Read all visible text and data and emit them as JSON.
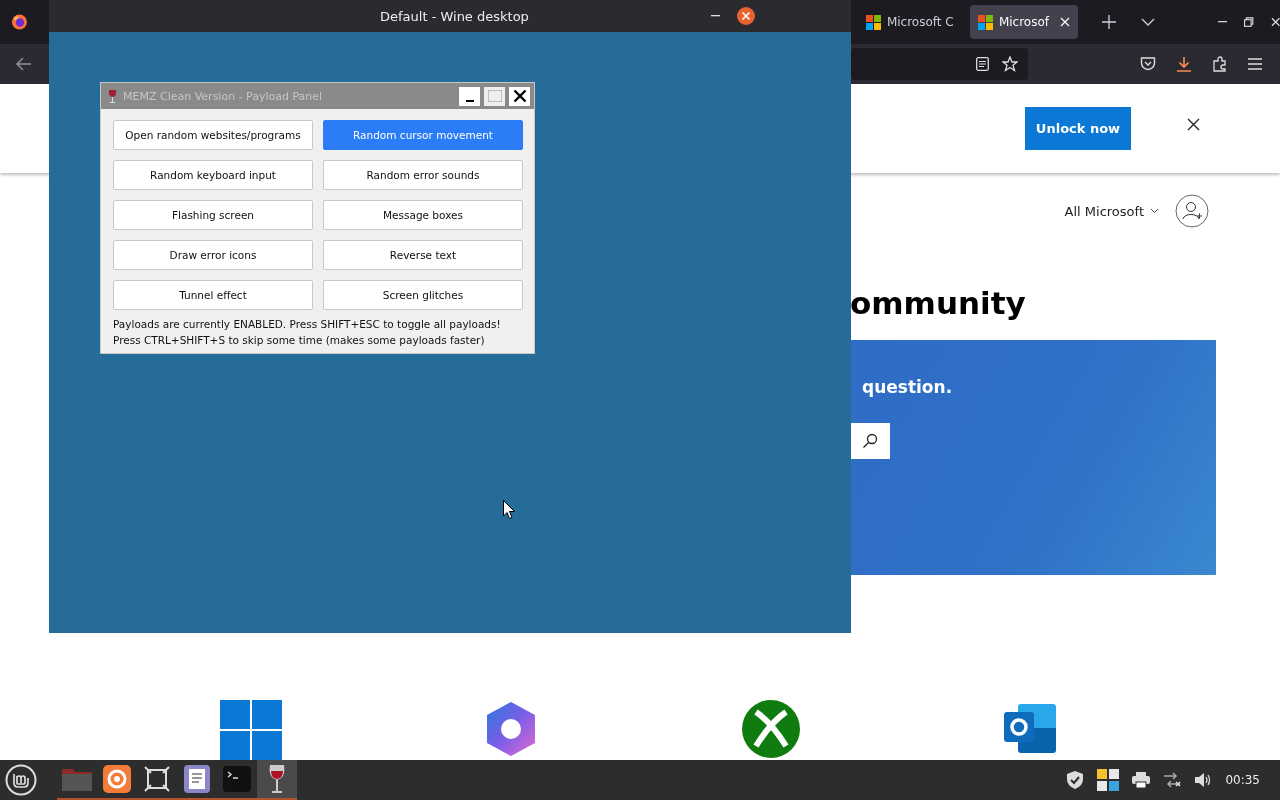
{
  "browser": {
    "tabs": [
      {
        "title": "Microsoft C",
        "selected": false
      },
      {
        "title": "Microsof",
        "selected": true
      }
    ]
  },
  "page": {
    "banner_button": "Unlock now",
    "nav_menu": "All Microsoft",
    "heading": "ommunity",
    "hero_text": "question."
  },
  "wine_window": {
    "title": "Default - Wine desktop"
  },
  "panel": {
    "title": "MEMZ Clean Version - Payload Panel",
    "payloads": [
      {
        "label": "Open random websites/programs",
        "selected": false
      },
      {
        "label": "Random cursor movement",
        "selected": true
      },
      {
        "label": "Random keyboard input",
        "selected": false
      },
      {
        "label": "Random error sounds",
        "selected": false
      },
      {
        "label": "Flashing screen",
        "selected": false
      },
      {
        "label": "Message boxes",
        "selected": false
      },
      {
        "label": "Draw error icons",
        "selected": false
      },
      {
        "label": "Reverse text",
        "selected": false
      },
      {
        "label": "Tunnel effect",
        "selected": false
      },
      {
        "label": "Screen glitches",
        "selected": false
      }
    ],
    "status_lines": [
      "Payloads are currently ENABLED. Press SHIFT+ESC to toggle all payloads!",
      "Press CTRL+SHIFT+S to skip some time (makes some payloads faster)"
    ]
  },
  "taskbar": {
    "apps": [
      {
        "kind": "files",
        "selected": false
      },
      {
        "kind": "firefox",
        "selected": false
      },
      {
        "kind": "frame",
        "selected": false
      },
      {
        "kind": "editor",
        "selected": false
      },
      {
        "kind": "terminal",
        "selected": false
      },
      {
        "kind": "wine",
        "selected": true
      }
    ],
    "clock": "00:35"
  }
}
